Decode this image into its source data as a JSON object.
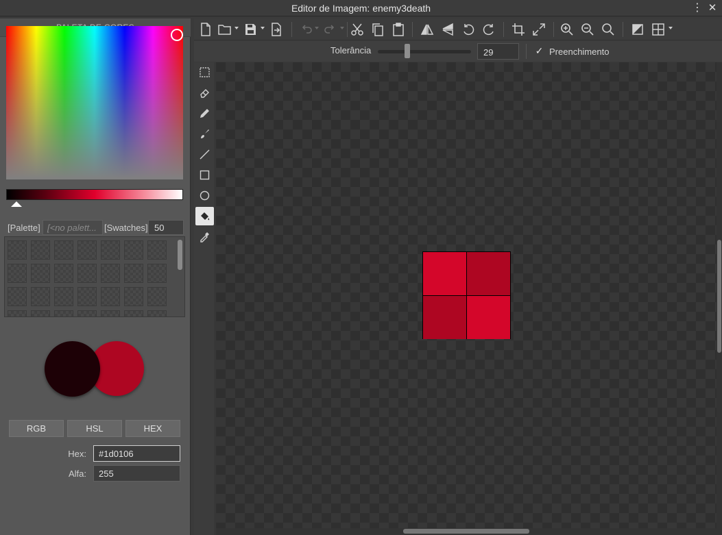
{
  "window": {
    "title": "Editor de Imagem: enemy3death",
    "menu_glyph": "⋮",
    "close_glyph": "✕"
  },
  "left_panel": {
    "header": "PALETA DE CORES",
    "palette_label": "[Palette]",
    "palette_placeholder": "[<no palett...",
    "swatches_label": "[Swatches]",
    "swatches_count": "50",
    "foreground_color": "#1d0106",
    "background_color": "#ae0622",
    "mode_buttons": [
      "RGB",
      "HSL",
      "HEX"
    ],
    "hex_label": "Hex:",
    "hex_value": "#1d0106",
    "alpha_label": "Alfa:",
    "alpha_value": "255"
  },
  "toolbar": {
    "icons": [
      "new-file-icon",
      "open-folder-icon",
      "save-icon",
      "export-icon",
      "undo-icon",
      "redo-icon",
      "cut-icon",
      "copy-icon",
      "paste-icon",
      "flip-horizontal-icon",
      "flip-vertical-icon",
      "rotate-left-icon",
      "rotate-right-icon",
      "crop-icon",
      "resize-icon",
      "zoom-in-icon",
      "zoom-out-icon",
      "zoom-reset-icon",
      "background-toggle-icon",
      "grid-icon"
    ]
  },
  "options": {
    "tolerance_label": "Tolerância",
    "tolerance_value": "29",
    "tolerance_fraction": 0.29,
    "fill_checked": true,
    "fill_label": "Preenchimento",
    "check_glyph": "✓"
  },
  "tools": {
    "items": [
      "select-rect-icon",
      "eraser-icon",
      "pencil-icon",
      "brush-icon",
      "line-icon",
      "rectangle-icon",
      "ellipse-icon",
      "fill-bucket-icon",
      "eyedropper-icon"
    ],
    "active": "fill-bucket-icon"
  },
  "canvas": {
    "pixels": [
      "#d4062a",
      "#ae0622",
      "#ae0622",
      "#d4062a"
    ]
  }
}
